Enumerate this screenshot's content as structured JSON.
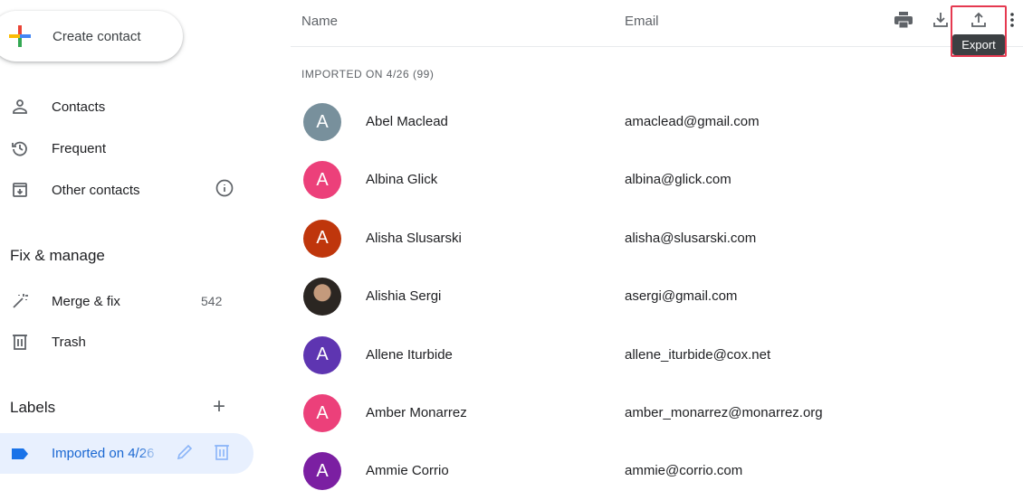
{
  "sidebar": {
    "create_label": "Create contact",
    "items": [
      {
        "label": "Contacts",
        "icon": "person-icon"
      },
      {
        "label": "Frequent",
        "icon": "history-icon"
      },
      {
        "label": "Other contacts",
        "icon": "inbox-download-icon"
      }
    ],
    "fix_heading": "Fix & manage",
    "merge_label": "Merge & fix",
    "merge_count": "542",
    "trash_label": "Trash",
    "labels_heading": "Labels",
    "active_label": "Imported on 4/26"
  },
  "header": {
    "name_col": "Name",
    "email_col": "Email",
    "tooltip": "Export"
  },
  "group_title": "IMPORTED ON 4/26 (99)",
  "contacts": [
    {
      "initial": "A",
      "name": "Abel Maclead",
      "email": "amaclead@gmail.com",
      "color": "#78909c"
    },
    {
      "initial": "A",
      "name": "Albina Glick",
      "email": "albina@glick.com",
      "color": "#ec407a"
    },
    {
      "initial": "A",
      "name": "Alisha Slusarski",
      "email": "alisha@slusarski.com",
      "color": "#bf360c"
    },
    {
      "initial": "",
      "name": "Alishia Sergi",
      "email": "asergi@gmail.com",
      "color": "#3e3a36"
    },
    {
      "initial": "A",
      "name": "Allene Iturbide",
      "email": "allene_iturbide@cox.net",
      "color": "#5e35b1"
    },
    {
      "initial": "A",
      "name": "Amber Monarrez",
      "email": "amber_monarrez@monarrez.org",
      "color": "#ec407a"
    },
    {
      "initial": "A",
      "name": "Ammie Corrio",
      "email": "ammie@corrio.com",
      "color": "#7b1fa2"
    }
  ]
}
